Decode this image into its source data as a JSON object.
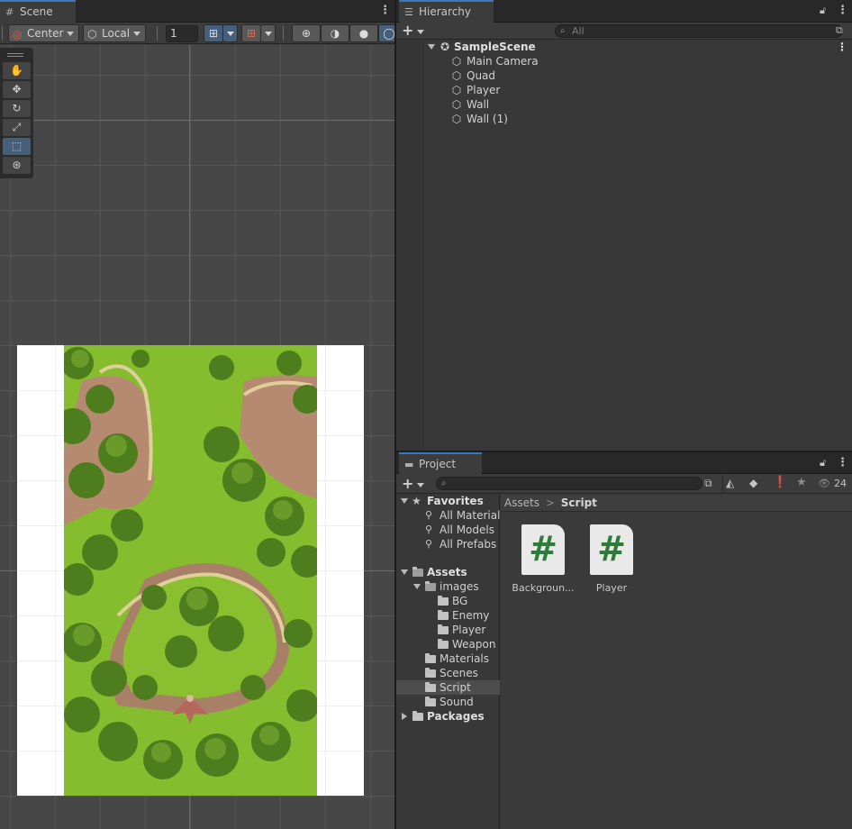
{
  "scene": {
    "tab_label": "Scene",
    "toolbar": {
      "pivot": "Center",
      "space": "Local",
      "grid_size": "1"
    },
    "tools": [
      "hand-tool",
      "move-tool",
      "rotate-tool",
      "scale-tool",
      "rect-tool",
      "transform-tool"
    ],
    "selected_tool": "rect-tool"
  },
  "hierarchy": {
    "tab_label": "Hierarchy",
    "search_placeholder": "All",
    "scene_name": "SampleScene",
    "objects": [
      "Main Camera",
      "Quad",
      "Player",
      "Wall",
      "Wall (1)"
    ]
  },
  "project": {
    "tab_label": "Project",
    "hidden_count": "24",
    "favorites": {
      "label": "Favorites",
      "items": [
        "All Materials",
        "All Models",
        "All Prefabs"
      ]
    },
    "assets_label": "Assets",
    "images_label": "images",
    "image_folders": [
      "BG",
      "Enemy",
      "Player",
      "Weapon"
    ],
    "asset_folders": [
      "Materials",
      "Scenes",
      "Script",
      "Sound"
    ],
    "selected_folder": "Script",
    "packages_label": "Packages",
    "breadcrumb": {
      "root": "Assets",
      "separator": ">",
      "current": "Script"
    },
    "files": [
      {
        "name": "Backgroun...",
        "glyph": "#"
      },
      {
        "name": "Player",
        "glyph": "#"
      }
    ]
  },
  "colors": {
    "accent": "#3a79bb",
    "selected_tool": "#46607c",
    "script_icon": "#2c7d3a"
  }
}
